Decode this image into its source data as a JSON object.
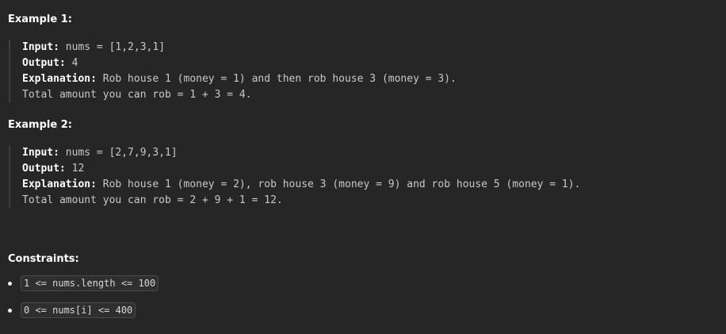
{
  "examples": [
    {
      "heading": "Example 1:",
      "input_label": "Input:",
      "input_value": " nums = [1,2,3,1]",
      "output_label": "Output:",
      "output_value": " 4",
      "explanation_label": "Explanation:",
      "explanation_value": " Rob house 1 (money = 1) and then rob house 3 (money = 3).",
      "total_line": "Total amount you can rob = 1 + 3 = 4."
    },
    {
      "heading": "Example 2:",
      "input_label": "Input:",
      "input_value": " nums = [2,7,9,3,1]",
      "output_label": "Output:",
      "output_value": " 12",
      "explanation_label": "Explanation:",
      "explanation_value": " Rob house 1 (money = 2), rob house 3 (money = 9) and rob house 5 (money = 1).",
      "total_line": "Total amount you can rob = 2 + 9 + 1 = 12."
    }
  ],
  "constraints": {
    "heading": "Constraints:",
    "items": [
      "1 <= nums.length <= 100",
      "0 <= nums[i] <= 400"
    ]
  }
}
